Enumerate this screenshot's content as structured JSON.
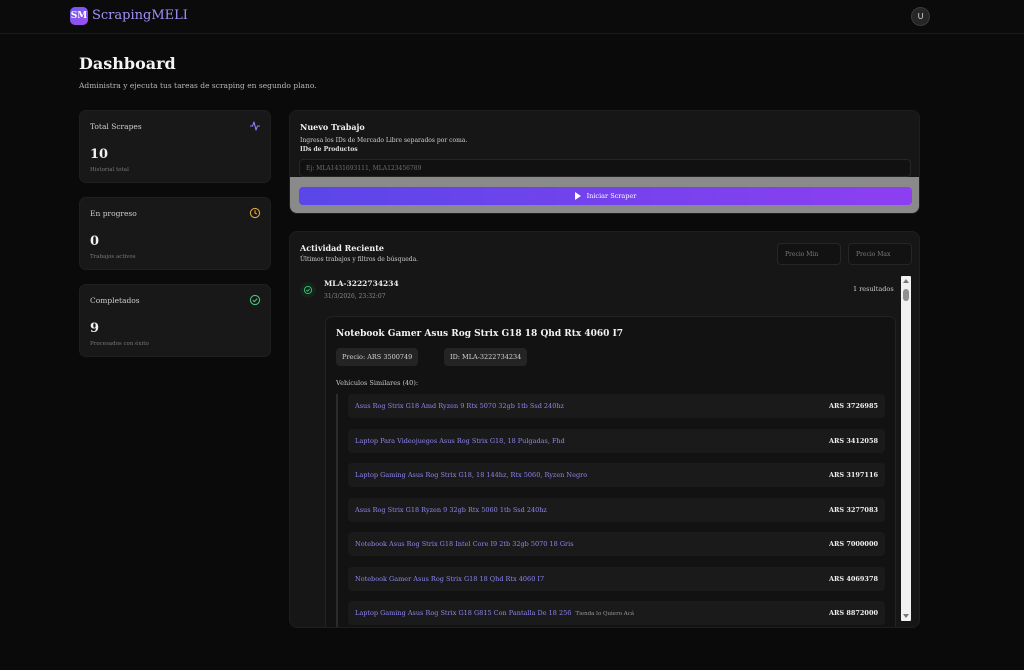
{
  "header": {
    "logo_badge": "SM",
    "logo_text": "ScrapingMELI",
    "avatar": "U"
  },
  "page": {
    "title": "Dashboard",
    "subtitle": "Administra y ejecuta tus tareas de scraping en segundo plano."
  },
  "stats": [
    {
      "label": "Total Scrapes",
      "value": "10",
      "hint": "Historial total",
      "icon": "activity-icon",
      "color": "#8b7df5"
    },
    {
      "label": "En progreso",
      "value": "0",
      "hint": "Trabajos activos",
      "icon": "clock-icon",
      "color": "#e0a33a"
    },
    {
      "label": "Completados",
      "value": "9",
      "hint": "Procesados con éxito",
      "icon": "check-circle-icon",
      "color": "#45c27a"
    }
  ],
  "nuevo": {
    "title": "Nuevo Trabajo",
    "desc": "Ingresa los IDs de Mercado Libre separados por coma.",
    "field_label": "IDs de Productos",
    "placeholder": "Ej: MLA1431693111, MLA123456789",
    "button": "Iniciar Scraper"
  },
  "activity": {
    "title": "Actividad Reciente",
    "desc": "Últimos trabajos y filtros de búsqueda.",
    "filter_min": "Precio Min",
    "filter_max": "Precio Max",
    "job": {
      "id": "MLA-3222734234",
      "time": "31/3/2026, 23:32:07",
      "count": "1 resultados",
      "product": {
        "name": "Notebook Gamer Asus Rog Strix G18 18 Qhd Rtx 4060 I7",
        "price": "Precio: ARS 3500749",
        "pid": "ID: MLA-3222734234",
        "similar_label": "Vehículos Similares (40):",
        "similar": [
          {
            "title": "Asus Rog Strix G18 Amd Ryzen 9 Rtx 5070 32gb 1tb Ssd 240hz",
            "price": "ARS 3726985",
            "store": ""
          },
          {
            "title": "Laptop Para Videojuegos Asus Rog Strix G18, 18 Pulgadas, Fhd",
            "price": "ARS 3412058",
            "store": ""
          },
          {
            "title": "Laptop Gaming Asus Rog Strix G18, 18 144hz, Rtx 5060, Ryzen Negro",
            "price": "ARS 3197116",
            "store": ""
          },
          {
            "title": "Asus Rog Strix G18 Ryzen 9 32gb Rtx 5060 1tb Ssd 240hz",
            "price": "ARS 3277083",
            "store": ""
          },
          {
            "title": "Notebook Asus Rog Strix G18 Intel Core I9 2tb 32gb 5070 18 Gris",
            "price": "ARS 7000000",
            "store": ""
          },
          {
            "title": "Notebook Gamer Asus Rog Strix G18 18 Qhd Rtx 4060 I7",
            "price": "ARS 4069378",
            "store": ""
          },
          {
            "title": "Laptop Gaming Asus Rog Strix G18 G815 Con Pantalla De 18 256",
            "price": "ARS 8872000",
            "store": "Tienda lo Quiero Acá"
          }
        ]
      }
    }
  }
}
